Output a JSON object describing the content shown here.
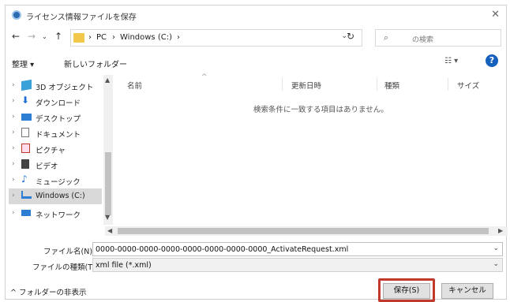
{
  "dialog": {
    "title": "ライセンス情報ファイルを保存"
  },
  "address": {
    "crumbs": [
      "PC",
      "Windows (C:)"
    ],
    "sep": "›"
  },
  "search": {
    "placeholder": "の検索"
  },
  "toolbar": {
    "organize": "整理 ▾",
    "new_folder": "新しいフォルダー"
  },
  "sidebar": {
    "items": [
      {
        "label": "3D オブジェクト",
        "icon": "3d-objects-icon"
      },
      {
        "label": "ダウンロード",
        "icon": "download-icon"
      },
      {
        "label": "デスクトップ",
        "icon": "desktop-icon"
      },
      {
        "label": "ドキュメント",
        "icon": "documents-icon"
      },
      {
        "label": "ピクチャ",
        "icon": "pictures-icon"
      },
      {
        "label": "ビデオ",
        "icon": "videos-icon"
      },
      {
        "label": "ミュージック",
        "icon": "music-icon"
      },
      {
        "label": "Windows (C:)",
        "icon": "drive-icon",
        "selected": true
      }
    ],
    "network": "ネットワーク"
  },
  "columns": [
    "名前",
    "更新日時",
    "種類",
    "サイズ"
  ],
  "empty_message": "検索条件に一致する項目はありません。",
  "filename": {
    "label": "ファイル名(N):",
    "value": "0000-0000-0000-0000-0000-0000-0000-0000_ActivateRequest.xml"
  },
  "filetype": {
    "label": "ファイルの種類(T):",
    "value": "xml file (*.xml)"
  },
  "bottom": {
    "hide_folders": "^ フォルダーの非表示",
    "save": "保存(S)",
    "cancel": "キャンセル"
  },
  "colors": {
    "highlight": "#c0392b",
    "help": "#1560bd",
    "folder": "#f2c84b"
  }
}
